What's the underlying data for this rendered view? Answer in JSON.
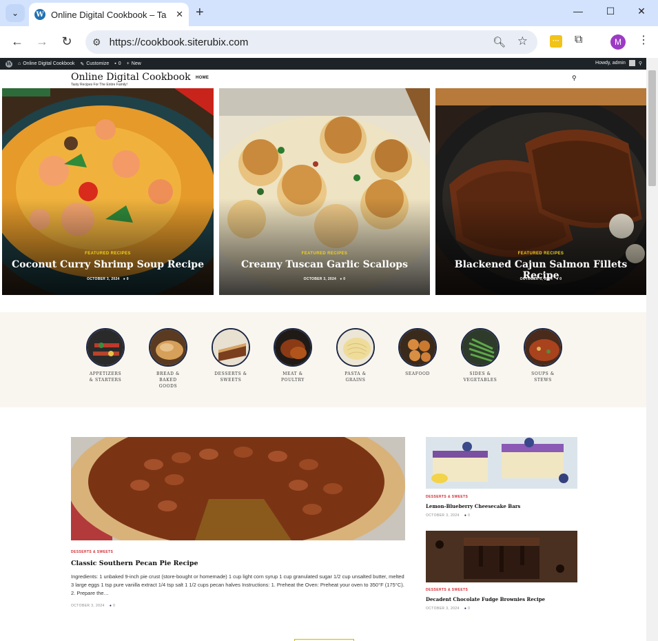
{
  "browser": {
    "tab_title": "Online Digital Cookbook – Tasty Recipes",
    "url": "https://cookbook.siterubix.com",
    "profile_initial": "M",
    "icons": [
      "chevron-down-icon",
      "wordpress-favicon",
      "close-icon",
      "plus-icon",
      "minimize-icon",
      "maximize-icon",
      "close-window-icon",
      "back-icon",
      "forward-icon",
      "reload-icon",
      "tune-icon",
      "zoom-icon",
      "star-icon",
      "extension-icon",
      "puzzle-icon",
      "kebab-icon"
    ]
  },
  "admin_bar": {
    "site_name": "Online Digital Cookbook",
    "customize": "Customize",
    "comments": "0",
    "new": "New",
    "howdy": "Howdy, admin"
  },
  "header": {
    "site_title": "Online Digital Cookbook",
    "tagline": "Tasty Recipes For The Entire Family!",
    "nav_home": "HOME"
  },
  "featured": [
    {
      "category": "FEATURED RECIPES",
      "title": "Coconut Curry Shrimp Soup Recipe",
      "date": "OCTOBER 3, 2024",
      "comments": "0"
    },
    {
      "category": "FEATURED RECIPES",
      "title": "Creamy Tuscan Garlic Scallops",
      "date": "OCTOBER 3, 2024",
      "comments": "0"
    },
    {
      "category": "FEATURED RECIPES",
      "title": "Blackened Cajun Salmon Fillets Recipe",
      "date": "OCTOBER 3, 2024",
      "comments": "0"
    }
  ],
  "categories": [
    {
      "label1": "APPETIZERS",
      "label2": "& STARTERS",
      "label3": ""
    },
    {
      "label1": "BREAD &",
      "label2": "BAKED",
      "label3": "GOODS"
    },
    {
      "label1": "DESSERTS &",
      "label2": "SWEETS",
      "label3": ""
    },
    {
      "label1": "MEAT &",
      "label2": "POULTRY",
      "label3": ""
    },
    {
      "label1": "PASTA &",
      "label2": "GRAINS",
      "label3": ""
    },
    {
      "label1": "SEAFOOD",
      "label2": "",
      "label3": ""
    },
    {
      "label1": "SIDES &",
      "label2": "VEGETABLES",
      "label3": ""
    },
    {
      "label1": "SOUPS &",
      "label2": "STEWS",
      "label3": ""
    }
  ],
  "main_post": {
    "category": "DESSERTS & SWEETS",
    "title": "Classic Southern Pecan Pie Recipe",
    "excerpt": "Ingredients: 1 unbaked 9-inch pie crust (store-bought or homemade) 1 cup light corn syrup 1 cup granulated sugar 1/2 cup unsalted butter, melted 3 large eggs 1 tsp pure vanilla extract 1/4 tsp salt 1 1/2 cups pecan halves Instructions: 1. Preheat the Oven: Preheat your oven to 350°F (175°C). 2. Prepare the…",
    "date": "OCTOBER 3, 2024",
    "comments": "0"
  },
  "side_posts": [
    {
      "category": "DESSERTS & SWEETS",
      "title": "Lemon-Blueberry Cheesecake Bars",
      "date": "OCTOBER 3, 2024",
      "comments": "0"
    },
    {
      "category": "DESSERTS & SWEETS",
      "title": "Decadent Chocolate Fudge Brownies Recipe",
      "date": "OCTOBER 3, 2024",
      "comments": "0"
    }
  ],
  "colors": {
    "chrome_tabstrip": "#d3e3fd",
    "admin_bar": "#1d2327",
    "accent_yellow": "#f3d21b",
    "category_red": "#d0272e",
    "navy_border": "#1c2744",
    "band_bg": "#f9f6f0"
  }
}
